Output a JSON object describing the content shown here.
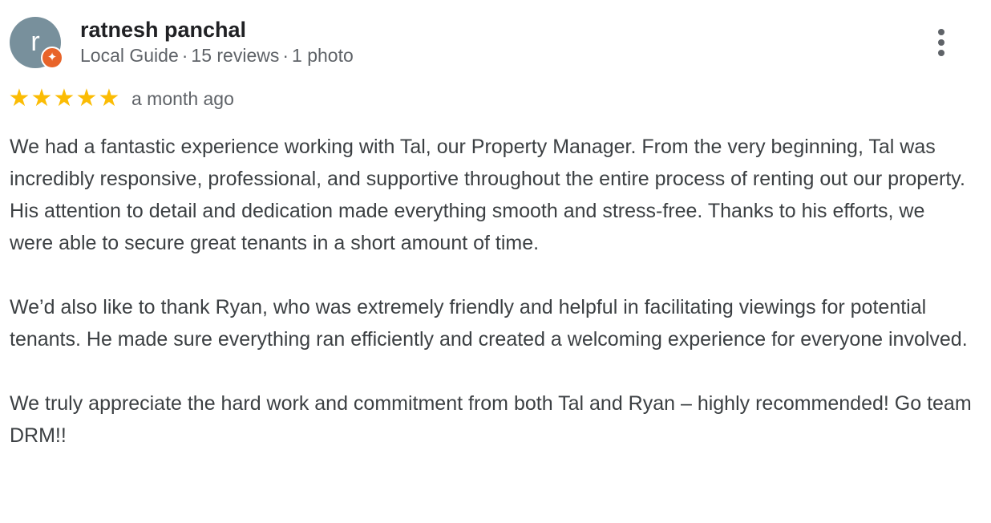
{
  "review": {
    "avatar_letter": "r",
    "avatar_color": "#78909c",
    "badge_icon": "local-guide-star-icon",
    "badge_color": "#e8642a",
    "author_name": "ratnesh panchal",
    "author_level": "Local Guide",
    "review_count": "15 reviews",
    "photo_count": "1 photo",
    "separator": "·",
    "more_icon": "more-vertical-icon",
    "rating": 5,
    "rating_max": 5,
    "star_color": "#fbbc04",
    "date": "a month ago",
    "paragraphs": [
      "We had a fantastic experience working with Tal, our Property Manager. From the very beginning, Tal was incredibly responsive, professional, and supportive throughout the entire process of renting out our property. His attention to detail and dedication made everything smooth and stress-free. Thanks to his efforts, we were able to secure great tenants in a short amount of time.",
      "We’d also like to thank Ryan, who was extremely friendly and helpful in facilitating viewings for potential tenants. He made sure everything ran efficiently and created a welcoming experience for everyone involved.",
      "We truly appreciate the hard work and commitment from both Tal and Ryan – highly recommended! Go team DRM!!"
    ]
  }
}
